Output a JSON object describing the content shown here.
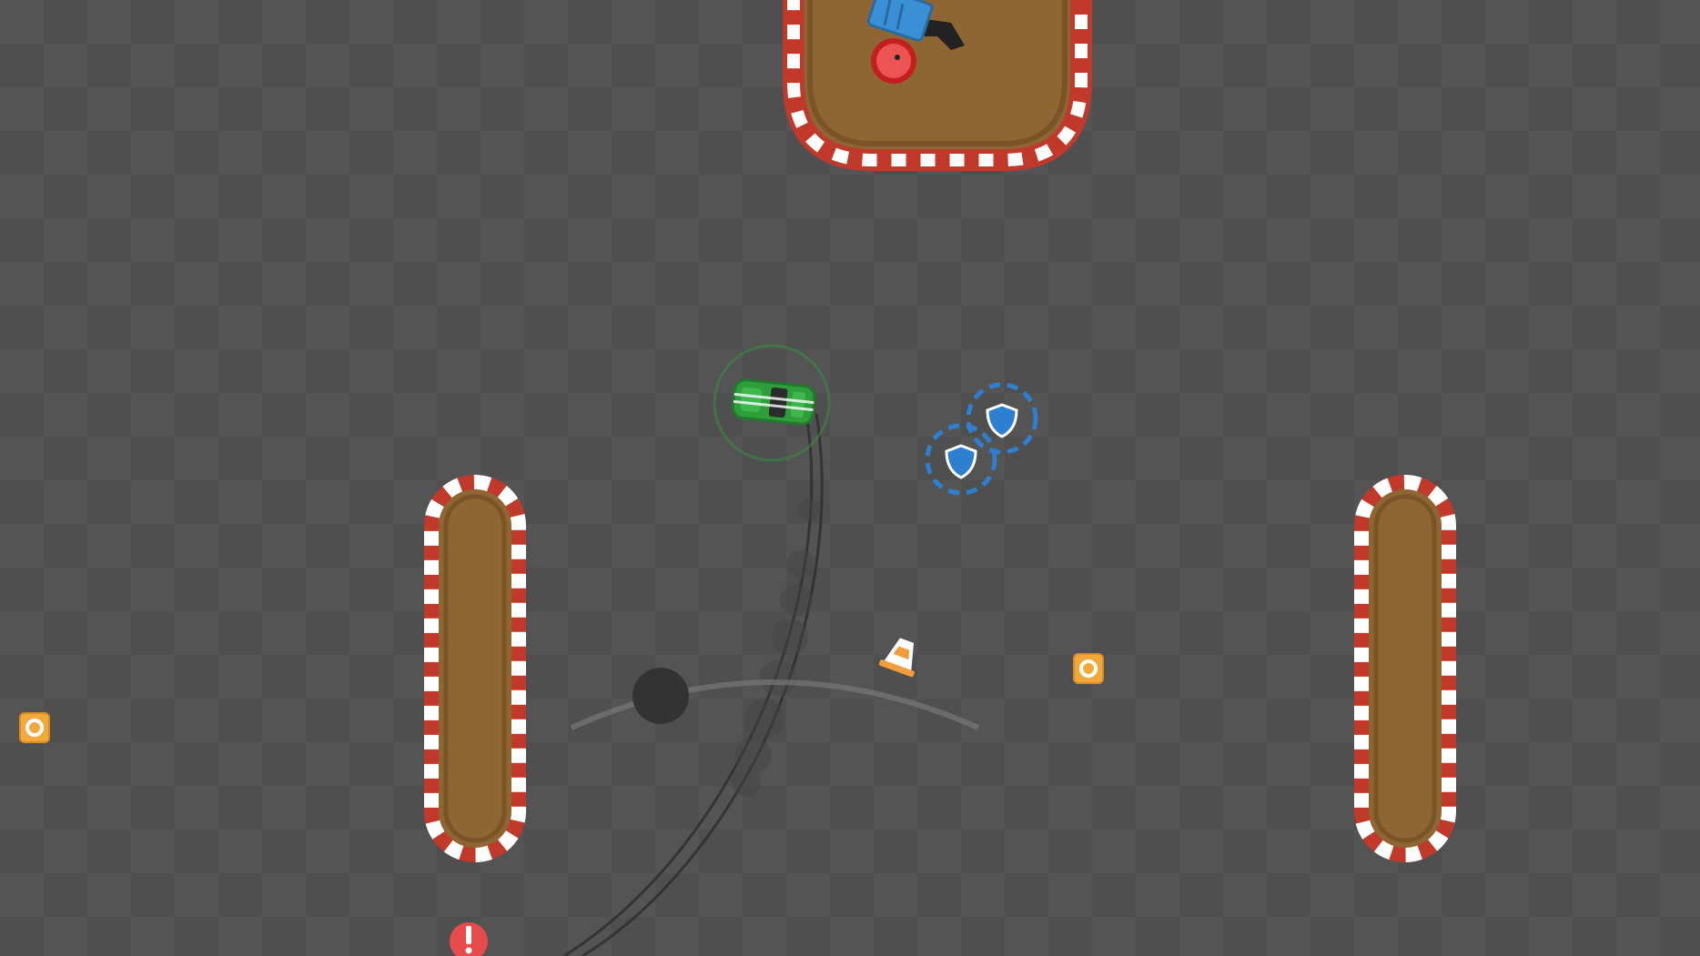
{
  "game": {
    "colors": {
      "asphalt": "#4e4e4e",
      "asphalt_tile": "#535353",
      "dirt": "#8d6634",
      "dirt_edge": "#7a5427",
      "curb_red": "#c0392b",
      "curb_white": "#ffffff",
      "player_car": "#2e9e3b",
      "turret_blue": "#3b8fd4",
      "mine_red": "#e43b3b",
      "coin_orange": "#f2a93b",
      "shield_blue": "#2f7fd0",
      "cone_orange": "#f39c3d"
    },
    "player": {
      "car_icon": "sports-car-icon",
      "aim_radius_indicator": "ring"
    },
    "pickups": {
      "shield_icon": "shield-icon",
      "coin_icon": "coin-icon",
      "cone_icon": "traffic-cone-icon",
      "warning_icon": "exclamation-icon",
      "mine_icon": "mine-icon",
      "turret_icon": "turret-icon"
    }
  }
}
